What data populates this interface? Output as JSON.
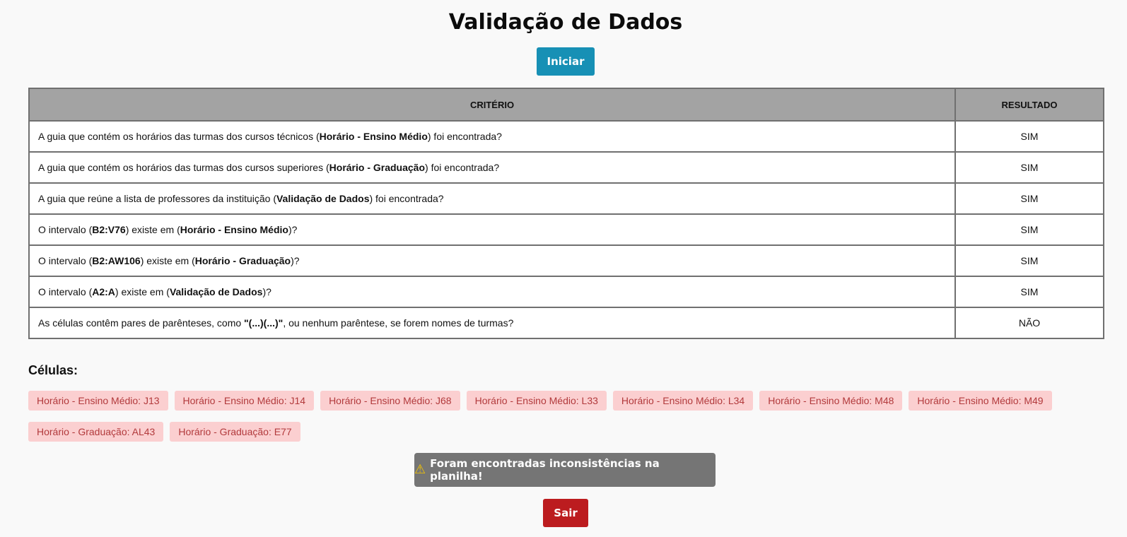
{
  "page": {
    "title": "Validação de Dados"
  },
  "actions": {
    "start_label": "Iniciar",
    "exit_label": "Sair"
  },
  "table": {
    "headers": {
      "criterion": "CRITÉRIO",
      "result": "RESULTADO"
    },
    "rows": [
      {
        "parts": [
          {
            "t": "A guia que contém os horários das turmas dos cursos técnicos ("
          },
          {
            "t": "Horário - Ensino Médio",
            "b": true
          },
          {
            "t": ") foi encontrada?"
          }
        ],
        "result": "SIM"
      },
      {
        "parts": [
          {
            "t": "A guia que contém os horários das turmas dos cursos superiores ("
          },
          {
            "t": "Horário - Graduação",
            "b": true
          },
          {
            "t": ") foi encontrada?"
          }
        ],
        "result": "SIM"
      },
      {
        "parts": [
          {
            "t": "A guia que reúne a lista de professores da instituição ("
          },
          {
            "t": "Validação de Dados",
            "b": true
          },
          {
            "t": ") foi encontrada?"
          }
        ],
        "result": "SIM"
      },
      {
        "parts": [
          {
            "t": "O intervalo ("
          },
          {
            "t": "B2:V76",
            "b": true
          },
          {
            "t": ") existe em ("
          },
          {
            "t": "Horário - Ensino Médio",
            "b": true
          },
          {
            "t": ")?"
          }
        ],
        "result": "SIM"
      },
      {
        "parts": [
          {
            "t": "O intervalo ("
          },
          {
            "t": "B2:AW106",
            "b": true
          },
          {
            "t": ") existe em ("
          },
          {
            "t": "Horário - Graduação",
            "b": true
          },
          {
            "t": ")?"
          }
        ],
        "result": "SIM"
      },
      {
        "parts": [
          {
            "t": "O intervalo ("
          },
          {
            "t": "A2:A",
            "b": true
          },
          {
            "t": ") existe em ("
          },
          {
            "t": "Validação de Dados",
            "b": true
          },
          {
            "t": ")?"
          }
        ],
        "result": "SIM"
      },
      {
        "parts": [
          {
            "t": "As células contêm pares de parênteses, como "
          },
          {
            "t": "\"(...)(...)\"",
            "b": true
          },
          {
            "t": ", ou nenhum parêntese, se forem nomes de turmas?"
          }
        ],
        "result": "NÃO"
      }
    ]
  },
  "cells": {
    "heading": "Células:",
    "items": [
      "Horário - Ensino Médio: J13",
      "Horário - Ensino Médio: J14",
      "Horário - Ensino Médio: J68",
      "Horário - Ensino Médio: L33",
      "Horário - Ensino Médio: L34",
      "Horário - Ensino Médio: M48",
      "Horário - Ensino Médio: M49",
      "Horário - Graduação: AL43",
      "Horário - Graduação: E77"
    ]
  },
  "alert": {
    "icon": "warning-icon",
    "text": "Foram encontradas inconsistências na planilha!"
  },
  "colors": {
    "start_button": "#1790b5",
    "exit_button": "#bc1c1f",
    "chip_bg": "#fbcfd0",
    "chip_text": "#b23a3c",
    "alert_bg": "#757575",
    "header_bg": "#a3a3a3"
  }
}
